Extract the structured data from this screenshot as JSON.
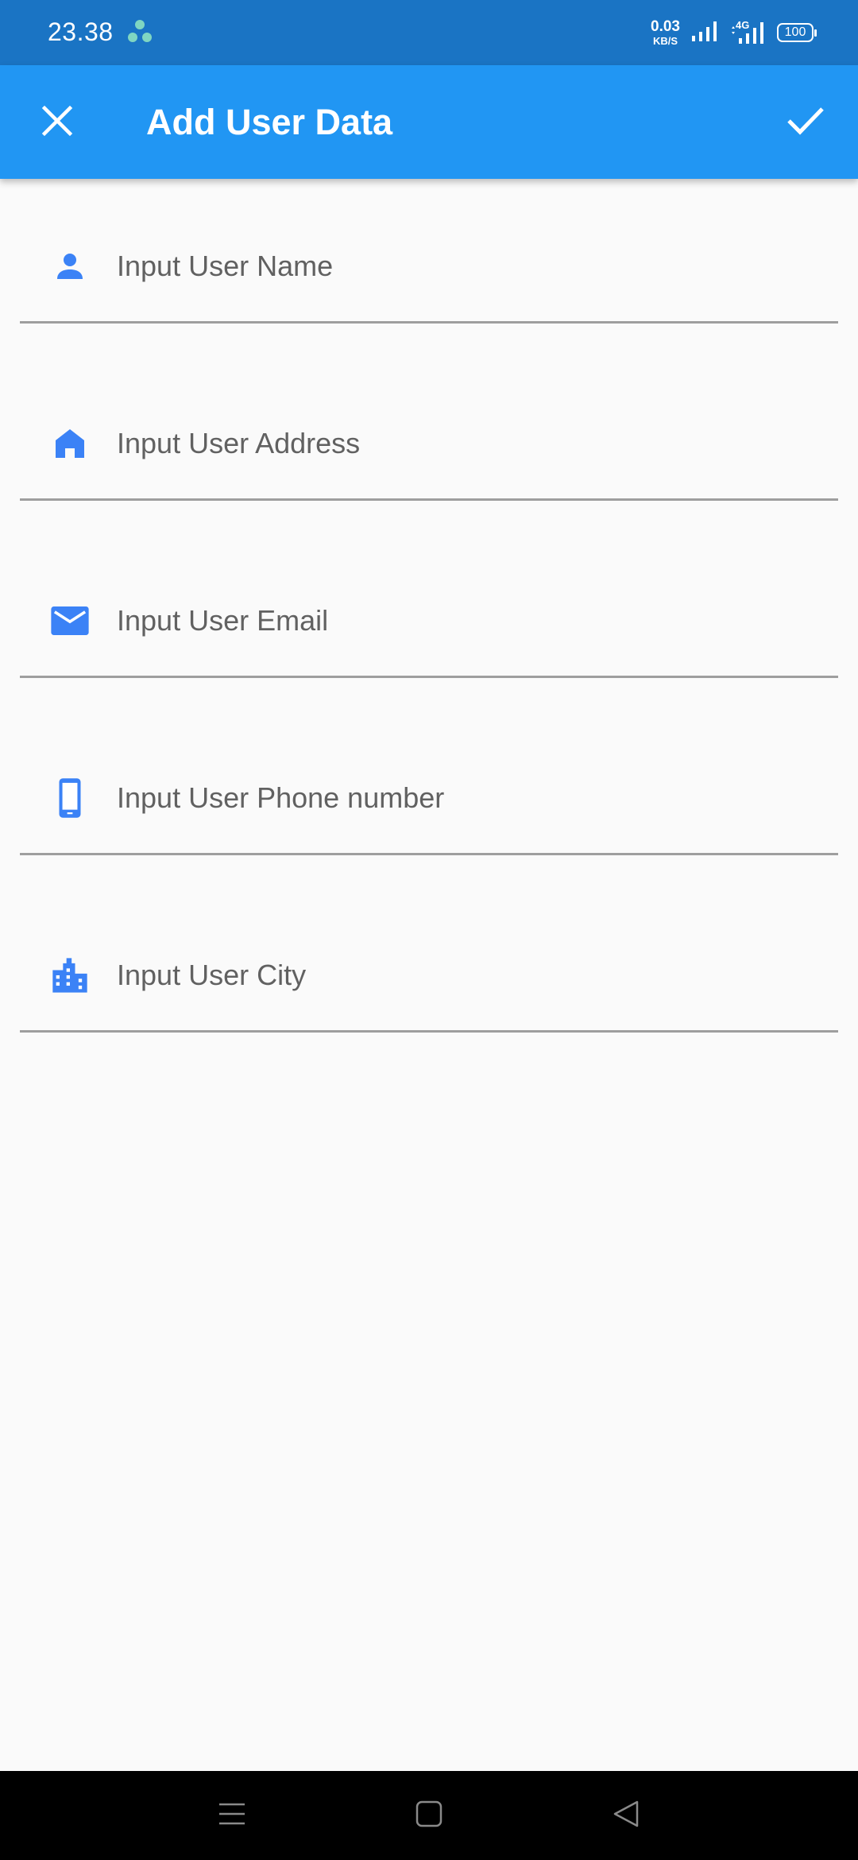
{
  "status_bar": {
    "time": "23.38",
    "net_speed_value": "0.03",
    "net_speed_unit": "KB/S",
    "network_type": "4G",
    "battery": "100"
  },
  "app_bar": {
    "title": "Add User Data",
    "close_icon": "close-icon",
    "confirm_icon": "check-icon"
  },
  "form": {
    "fields": [
      {
        "icon": "person-icon",
        "placeholder": "Input User Name",
        "value": ""
      },
      {
        "icon": "home-icon",
        "placeholder": "Input User Address",
        "value": ""
      },
      {
        "icon": "email-icon",
        "placeholder": "Input User Email",
        "value": ""
      },
      {
        "icon": "phone-icon",
        "placeholder": "Input User Phone number",
        "value": ""
      },
      {
        "icon": "city-icon",
        "placeholder": "Input User City",
        "value": ""
      }
    ]
  },
  "colors": {
    "status_bar": "#1a74c4",
    "app_bar": "#2196f3",
    "icon_blue": "#3b82f6",
    "background": "#fafafa"
  },
  "nav_bar": {
    "buttons": [
      "menu-icon",
      "home-square-icon",
      "back-triangle-icon"
    ]
  }
}
